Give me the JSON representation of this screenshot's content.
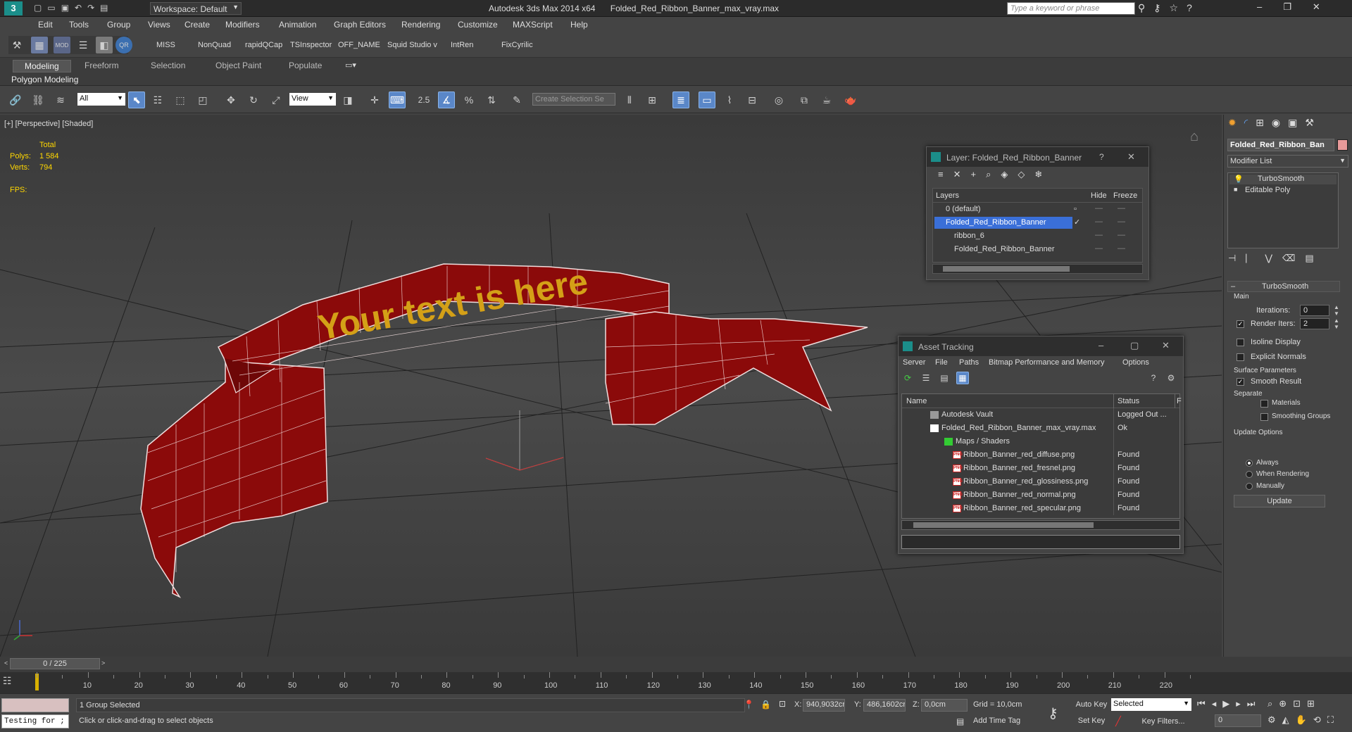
{
  "window": {
    "workspace_label": "Workspace: Default",
    "app_title": "Autodesk 3ds Max  2014 x64",
    "file_title": "Folded_Red_Ribbon_Banner_max_vray.max",
    "search_placeholder": "Type a keyword or phrase"
  },
  "menu": [
    "Edit",
    "Tools",
    "Group",
    "Views",
    "Create",
    "Modifiers",
    "Animation",
    "Graph Editors",
    "Rendering",
    "Customize",
    "MAXScript",
    "Help"
  ],
  "toolbar1": [
    "MISS",
    "NonQuad",
    "rapidQCap",
    "TSInspector",
    "OFF_NAME",
    "Squid Studio v",
    "IntRen",
    "FixCyrilic"
  ],
  "ribbon": {
    "tabs": [
      "Modeling",
      "Freeform",
      "Selection",
      "Object Paint",
      "Populate"
    ],
    "sub_label": "Polygon Modeling"
  },
  "maintoolbar": {
    "filter_value": "All",
    "refcoord_value": "View",
    "selset_placeholder": "Create Selection Se",
    "snap_label": "2.5"
  },
  "viewport": {
    "label": "[+] [Perspective] [Shaded]",
    "stats": {
      "header": "Total",
      "polys_label": "Polys:",
      "polys": "1 584",
      "verts_label": "Verts:",
      "verts": "794",
      "fps_label": "FPS:"
    },
    "banner_text": "Your text is here",
    "colors": {
      "ribbon": "#8b0a0a",
      "text": "#d4a017"
    }
  },
  "layer_dialog": {
    "title": "Layer: Folded_Red_Ribbon_Banner",
    "help": "?",
    "cols": {
      "layers": "Layers",
      "hide": "Hide",
      "freeze": "Freeze"
    },
    "rows": [
      {
        "name": "0 (default)"
      },
      {
        "name": "Folded_Red_Ribbon_Banner"
      },
      {
        "name": "ribbon_6"
      },
      {
        "name": "Folded_Red_Ribbon_Banner"
      }
    ]
  },
  "asset_tracking": {
    "title": "Asset Tracking",
    "menu": [
      "Server",
      "File",
      "Paths",
      "Bitmap Performance and Memory",
      "Options"
    ],
    "cols": {
      "name": "Name",
      "status": "Status",
      "extra": "F"
    },
    "rows": [
      {
        "name": "Autodesk Vault",
        "status": "Logged Out ..."
      },
      {
        "name": "Folded_Red_Ribbon_Banner_max_vray.max",
        "status": "Ok"
      },
      {
        "name": "Maps / Shaders",
        "status": ""
      },
      {
        "name": "Ribbon_Banner_red_diffuse.png",
        "status": "Found"
      },
      {
        "name": "Ribbon_Banner_red_fresnel.png",
        "status": "Found"
      },
      {
        "name": "Ribbon_Banner_red_glossiness.png",
        "status": "Found"
      },
      {
        "name": "Ribbon_Banner_red_normal.png",
        "status": "Found"
      },
      {
        "name": "Ribbon_Banner_red_specular.png",
        "status": "Found"
      }
    ],
    "png_tag": "PNG"
  },
  "cmdpanel": {
    "object_name": "Folded_Red_Ribbon_Ban",
    "object_color": "#e89a9a",
    "modifier_list": "Modifier List",
    "stack": [
      "TurboSmooth",
      "Editable Poly"
    ],
    "rollout_title": "TurboSmooth",
    "main_label": "Main",
    "iterations_label": "Iterations:",
    "iterations": "0",
    "render_iters_label": "Render Iters:",
    "render_iters": "2",
    "isoline": "Isoline Display",
    "explicit": "Explicit Normals",
    "surface_label": "Surface Parameters",
    "smooth_result": "Smooth Result",
    "separate_label": "Separate",
    "materials": "Materials",
    "smoothing_groups": "Smoothing Groups",
    "update_options_label": "Update Options",
    "always": "Always",
    "when_rendering": "When Rendering",
    "manually": "Manually",
    "update_button": "Update"
  },
  "timeline": {
    "frame": "0 / 225",
    "ticks": [
      "10",
      "20",
      "30",
      "40",
      "50",
      "60",
      "70",
      "80",
      "90",
      "100",
      "110",
      "120",
      "130",
      "140",
      "150",
      "160",
      "170",
      "180",
      "190",
      "200",
      "210",
      "220"
    ]
  },
  "status": {
    "script_text": "Testing for ;",
    "selected": "1 Group Selected",
    "prompt": "Click or click-and-drag to select objects",
    "x_label": "X:",
    "x": "940,9032cr",
    "y_label": "Y:",
    "y": "486,1602cr",
    "z_label": "Z:",
    "z": "0,0cm",
    "grid": "Grid = 10,0cm",
    "add_time_tag": "Add Time Tag",
    "auto_key": "Auto Key",
    "set_key": "Set Key",
    "selected_dropdown": "Selected",
    "key_filters": "Key Filters...",
    "frame_value": "0"
  }
}
